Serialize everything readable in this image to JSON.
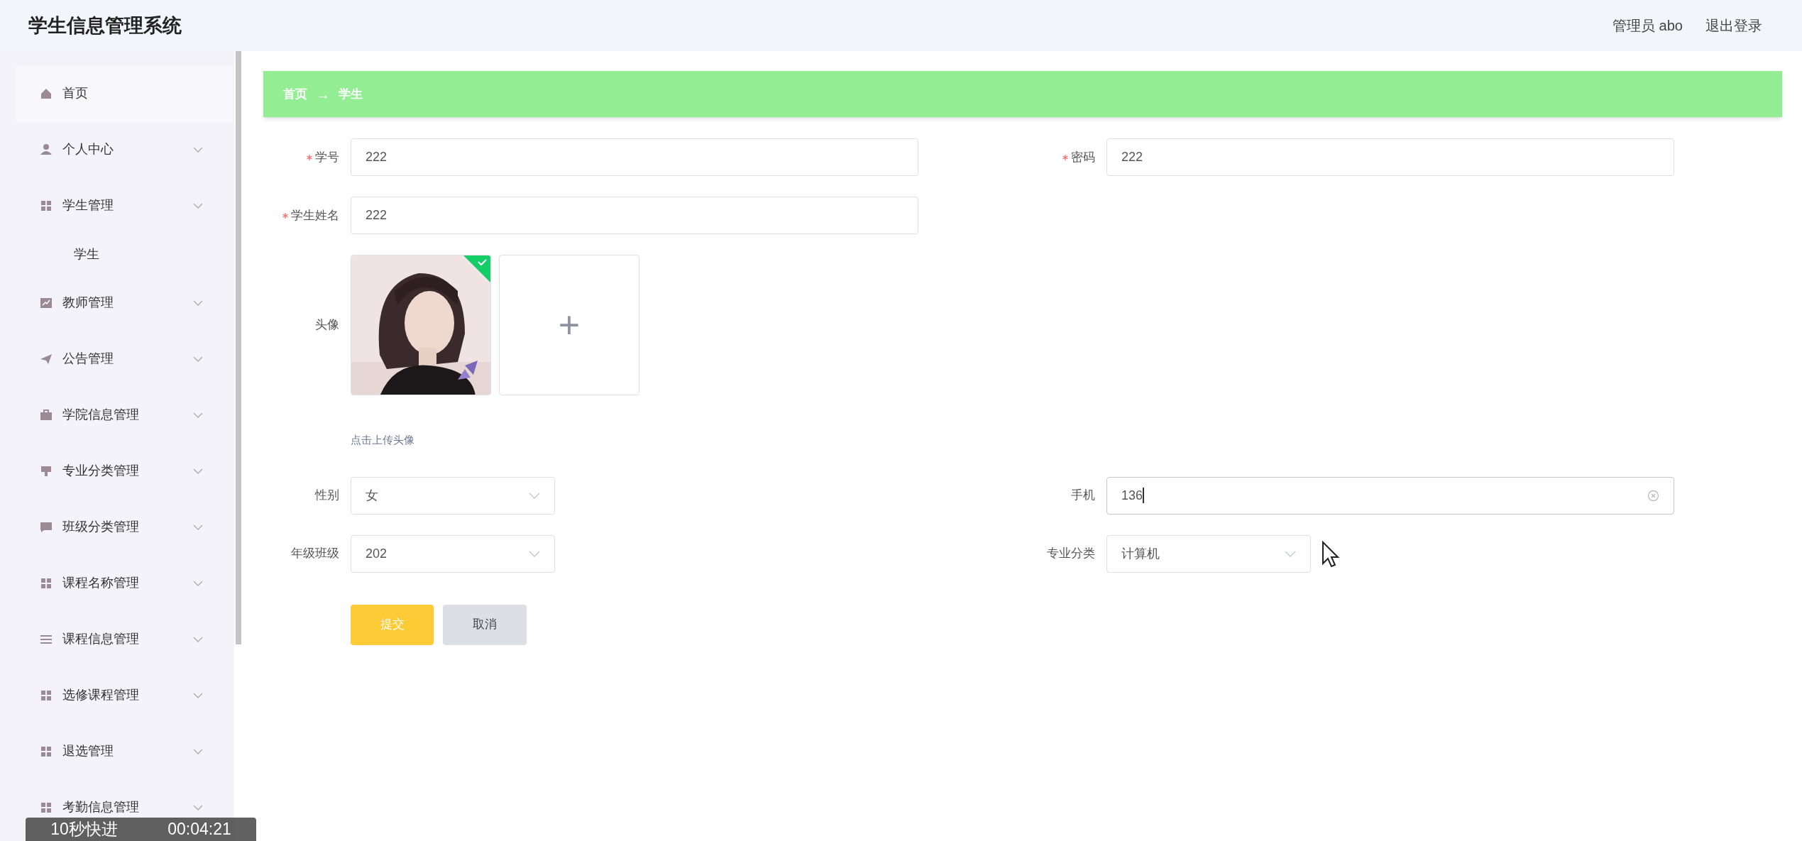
{
  "header": {
    "title": "学生信息管理系统",
    "user": "管理员 abo",
    "logout": "退出登录"
  },
  "sidebar": {
    "items": [
      {
        "label": "首页",
        "kind": "link",
        "selected": true
      },
      {
        "label": "个人中心",
        "kind": "submenu",
        "selected": false
      },
      {
        "label": "学生管理",
        "kind": "submenu",
        "selected": false,
        "children": [
          {
            "label": "学生",
            "selected": false
          }
        ]
      },
      {
        "label": "教师管理",
        "kind": "submenu",
        "selected": false
      },
      {
        "label": "公告管理",
        "kind": "submenu",
        "selected": false
      },
      {
        "label": "学院信息管理",
        "kind": "submenu",
        "selected": false
      },
      {
        "label": "专业分类管理",
        "kind": "submenu",
        "selected": false
      },
      {
        "label": "班级分类管理",
        "kind": "submenu",
        "selected": false
      },
      {
        "label": "课程名称管理",
        "kind": "submenu",
        "selected": false
      },
      {
        "label": "课程信息管理",
        "kind": "submenu",
        "selected": false
      },
      {
        "label": "选修课程管理",
        "kind": "submenu",
        "selected": false
      },
      {
        "label": "退选管理",
        "kind": "submenu",
        "selected": false
      },
      {
        "label": "考勤信息管理",
        "kind": "submenu",
        "selected": false
      }
    ]
  },
  "breadcrumb": {
    "items": [
      "首页",
      "学生"
    ],
    "separator": "→"
  },
  "form": {
    "rows": [
      {
        "fields": [
          {
            "kind": "text",
            "label": "学号",
            "required": true,
            "value": "222",
            "focused": false
          },
          {
            "kind": "text",
            "label": "密码",
            "required": true,
            "value": "222",
            "focused": false
          }
        ]
      },
      {
        "fields": [
          {
            "kind": "text",
            "label": "学生姓名",
            "required": true,
            "value": "222",
            "focused": false
          }
        ]
      },
      {
        "fields": [
          {
            "kind": "upload",
            "label": "头像",
            "required": false,
            "uploaded": true,
            "hint": "点击上传头像",
            "add": "+"
          }
        ]
      },
      {
        "fields": [
          {
            "kind": "select",
            "label": "性别",
            "required": false,
            "value": "女"
          },
          {
            "kind": "text",
            "label": "手机",
            "required": false,
            "value": "136",
            "focused": true
          }
        ]
      },
      {
        "fields": [
          {
            "kind": "select",
            "label": "年级班级",
            "required": false,
            "value": "202"
          },
          {
            "kind": "select",
            "label": "专业分类",
            "required": false,
            "value": "计算机"
          }
        ]
      }
    ],
    "buttons": [
      {
        "kind": "primary",
        "label": "提交"
      },
      {
        "kind": "secondary",
        "label": "取消"
      }
    ]
  },
  "player": {
    "skip": "10秒快进",
    "time": "00:04:21"
  }
}
